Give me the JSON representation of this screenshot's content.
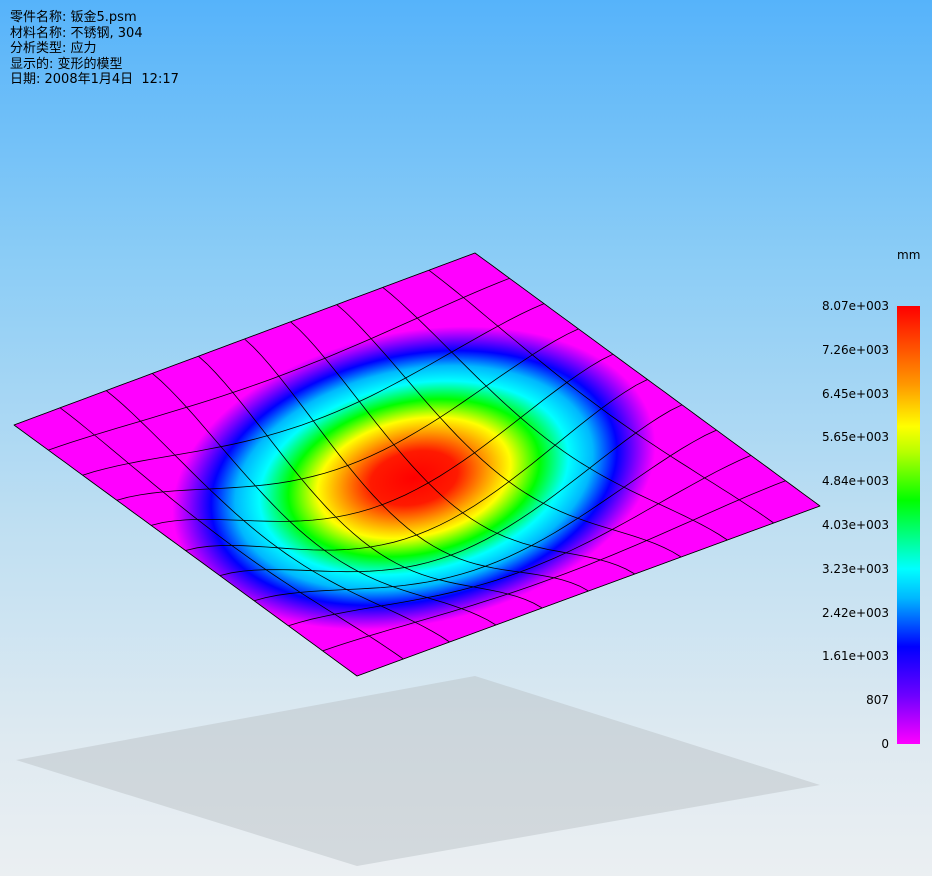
{
  "info": {
    "part_name": "零件名称: 钣金5.psm",
    "material": "材料名称: 不锈钢, 304",
    "analysis_type": "分析类型: 应力",
    "display": "显示的: 变形的模型",
    "date": "日期: 2008年1月4日  12:17"
  },
  "legend": {
    "unit": "mm",
    "ticks": [
      "8.07e+003",
      "7.26e+003",
      "6.45e+003",
      "5.65e+003",
      "4.84e+003",
      "4.03e+003",
      "3.23e+003",
      "2.42e+003",
      "1.61e+003",
      "807",
      "0"
    ],
    "min": 0,
    "max": 8070,
    "colors": {
      "low": "#ff00ff",
      "mid_low": "#0000ff",
      "mid": "#00ffff",
      "mid_high": "#00ff00",
      "high_mid": "#ffff00",
      "high": "#ff0000"
    }
  },
  "mesh": {
    "divisions": 10
  }
}
